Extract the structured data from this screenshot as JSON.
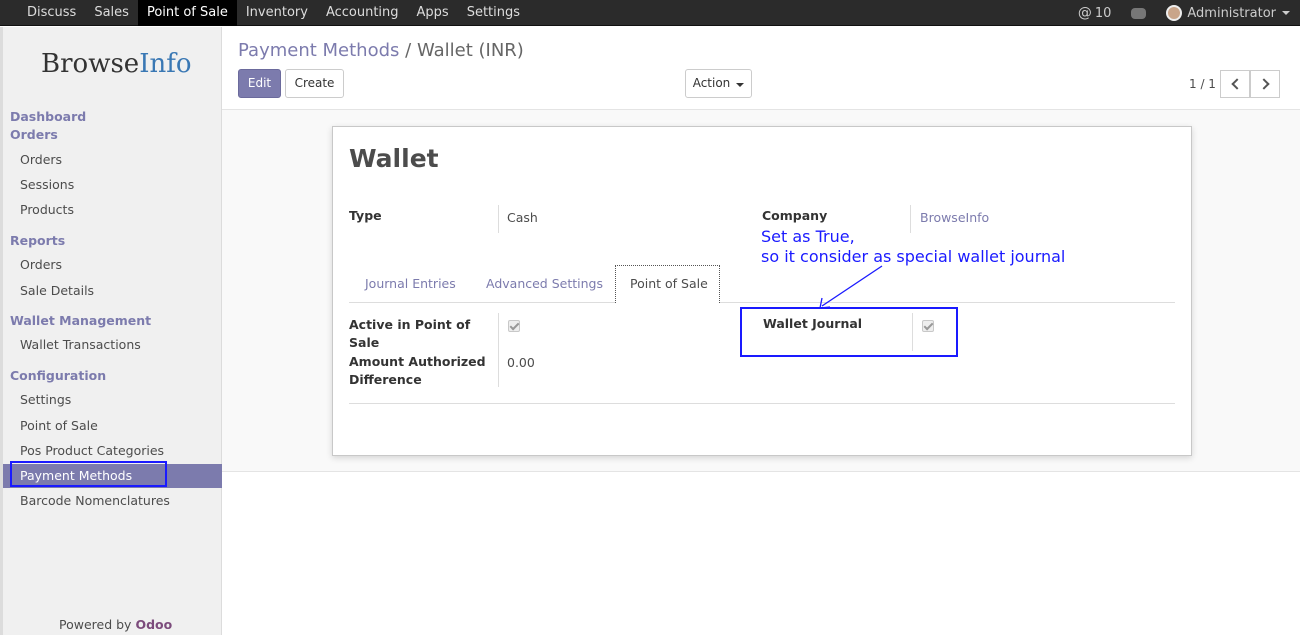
{
  "topbar": {
    "menu": [
      "Discuss",
      "Sales",
      "Point of Sale",
      "Inventory",
      "Accounting",
      "Apps",
      "Settings"
    ],
    "active_index": 2,
    "mentions_count": "10",
    "user": "Administrator"
  },
  "sidebar": {
    "logo_a": "Browse",
    "logo_b": "Info",
    "sections": {
      "dashboard": "Dashboard",
      "orders": "Orders",
      "reports": "Reports",
      "wallet": "Wallet Management",
      "configuration": "Configuration"
    },
    "items": {
      "orders": "Orders",
      "sessions": "Sessions",
      "products": "Products",
      "report_orders": "Orders",
      "sale_details": "Sale Details",
      "wallet_transactions": "Wallet Transactions",
      "settings": "Settings",
      "point_of_sale": "Point of Sale",
      "pos_categories": "Pos Product Categories",
      "payment_methods": "Payment Methods",
      "barcode": "Barcode Nomenclatures"
    },
    "powered_by": "Powered by",
    "powered_brand": "Odoo"
  },
  "control": {
    "breadcrumb_parent": "Payment Methods",
    "breadcrumb_sep": "/",
    "breadcrumb_current": "Wallet (INR)",
    "edit": "Edit",
    "create": "Create",
    "action": "Action",
    "pager": "1 / 1"
  },
  "form": {
    "title": "Wallet",
    "type_label": "Type",
    "type_value": "Cash",
    "company_label": "Company",
    "company_value": "BrowseInfo",
    "tabs": [
      "Journal Entries",
      "Advanced Settings",
      "Point of Sale"
    ],
    "active_tab": "Point of Sale",
    "active_pos_label_1": "Active in Point of",
    "active_pos_label_2": "Sale",
    "active_pos_checked": true,
    "amount_label_1": "Amount Authorized",
    "amount_label_2": "Difference",
    "amount_value": "0.00",
    "wallet_journal_label": "Wallet Journal",
    "wallet_journal_checked": true
  },
  "annotation": {
    "line1": "Set as True,",
    "line2": "so it consider as special wallet journal",
    "color": "#1a1aff"
  }
}
